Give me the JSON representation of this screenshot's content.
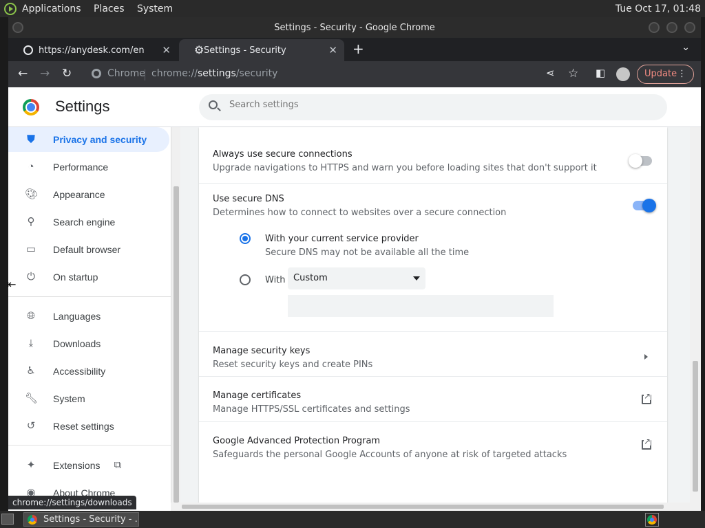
{
  "desktop": {
    "menus": [
      "Applications",
      "Places",
      "System"
    ],
    "clock": "Tue Oct 17, 01:48"
  },
  "window": {
    "title": "Settings - Security - Google Chrome"
  },
  "tabs": [
    {
      "label": "https://anydesk.com/en"
    },
    {
      "label": "Settings - Security"
    }
  ],
  "toolbar": {
    "omnibox_chip": "Chrome",
    "url_prefix": "chrome://",
    "url_host": "settings",
    "url_path": "/security",
    "update_label": "Update"
  },
  "header": {
    "title": "Settings",
    "search_placeholder": "Search settings"
  },
  "sidebar": {
    "items": [
      {
        "label": "Privacy and security",
        "icon": "shield-icon",
        "active": true
      },
      {
        "label": "Performance",
        "icon": "speedometer-icon"
      },
      {
        "label": "Appearance",
        "icon": "palette-icon"
      },
      {
        "label": "Search engine",
        "icon": "search-icon"
      },
      {
        "label": "Default browser",
        "icon": "browser-window-icon"
      },
      {
        "label": "On startup",
        "icon": "power-icon"
      },
      {
        "label": "Languages",
        "icon": "globe-icon"
      },
      {
        "label": "Downloads",
        "icon": "download-icon"
      },
      {
        "label": "Accessibility",
        "icon": "accessibility-icon"
      },
      {
        "label": "System",
        "icon": "wrench-icon"
      },
      {
        "label": "Reset settings",
        "icon": "history-icon"
      },
      {
        "label": "Extensions",
        "icon": "puzzle-icon"
      },
      {
        "label": "About Chrome",
        "icon": "chrome-icon"
      }
    ]
  },
  "content": {
    "https_title": "Always use secure connections",
    "https_sub": "Upgrade navigations to HTTPS and warn you before loading sites that don't support it",
    "https_enabled": false,
    "dns_title": "Use secure DNS",
    "dns_sub": "Determines how to connect to websites over a secure connection",
    "dns_enabled": true,
    "dns_option1_title": "With your current service provider",
    "dns_option1_sub": "Secure DNS may not be available all the time",
    "dns_option2_label": "With",
    "dns_select_value": "Custom",
    "keys_title": "Manage security keys",
    "keys_sub": "Reset security keys and create PINs",
    "certs_title": "Manage certificates",
    "certs_sub": "Manage HTTPS/SSL certificates and settings",
    "gapp_title": "Google Advanced Protection Program",
    "gapp_sub": "Safeguards the personal Google Accounts of anyone at risk of targeted attacks"
  },
  "status_url": "chrome://settings/downloads",
  "taskbar": {
    "item_label": "Settings - Security - ..."
  },
  "colors": {
    "accent": "#1a73e8",
    "active_bg": "#e8f0fe",
    "update": "#f28b82"
  }
}
